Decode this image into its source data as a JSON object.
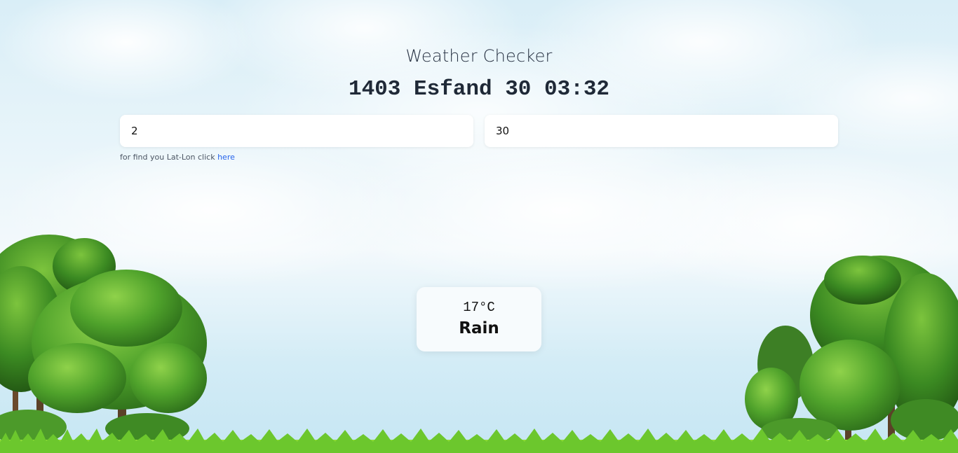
{
  "app": {
    "title": "Weather Checker",
    "datetime": "1403 Esfand 30 03:32"
  },
  "inputs": {
    "latitude_value": "2",
    "longitude_value": "30"
  },
  "hint": {
    "text": "for find you Lat-Lon click ",
    "link_label": "here"
  },
  "weather": {
    "temperature": "17°C",
    "condition": "Rain"
  },
  "colors": {
    "link": "#2563eb",
    "sky": "#d9eef7",
    "grass": "#5cbf2a",
    "tree": "#3f8f26"
  }
}
